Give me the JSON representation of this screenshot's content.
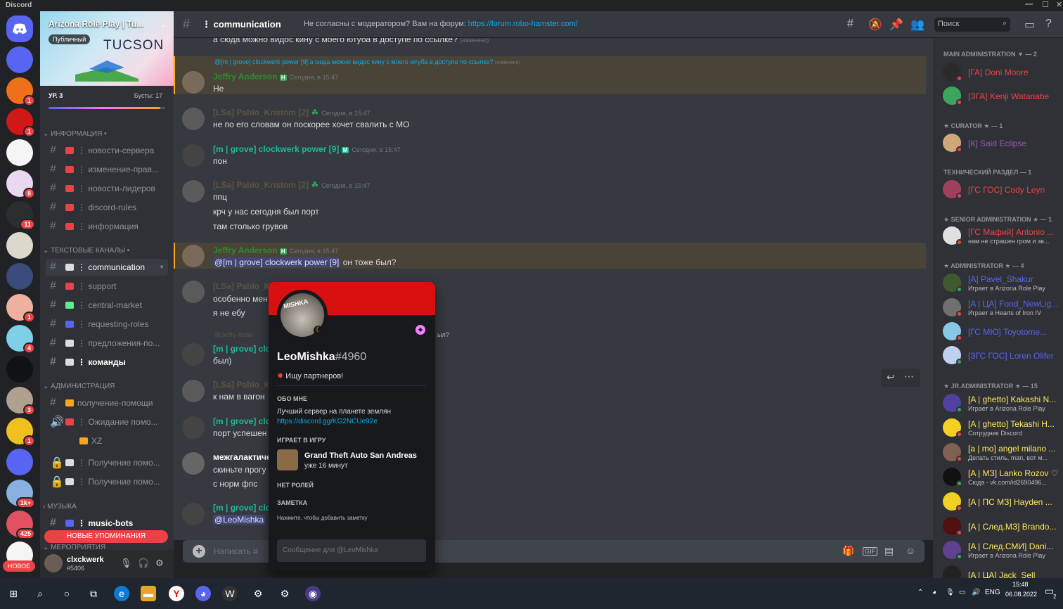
{
  "window": {
    "title": "Discord"
  },
  "rail": {
    "servers": [
      {
        "badge": ""
      },
      {
        "badge": "1"
      },
      {
        "badge": "1"
      },
      {
        "badge": ""
      },
      {
        "badge": "8"
      },
      {
        "badge": "11"
      },
      {
        "badge": ""
      },
      {
        "badge": ""
      },
      {
        "badge": "1"
      },
      {
        "badge": "4"
      },
      {
        "badge": ""
      },
      {
        "badge": "3"
      },
      {
        "badge": "1"
      },
      {
        "badge": ""
      },
      {
        "badge": "1k+"
      },
      {
        "badge": "425"
      },
      {
        "badge": ""
      }
    ],
    "new_label": "НОВОЕ",
    "colors": [
      "#5865f2",
      "#f0701a",
      "#d01818",
      "#f5f5f5",
      "#e8d8f0",
      "#2b2d31",
      "#ddd8cc",
      "#3a4a7a",
      "#f0b0a0",
      "#7ed0e8",
      "#111214",
      "#b0a090",
      "#f0c020",
      "#5865f2",
      "#88b0e0",
      "#e05060",
      "#f5f5f5"
    ]
  },
  "server": {
    "name": "Arizona Role Play | Tu...",
    "public": "Публичный",
    "logo_text": "TUCSON",
    "level": "УР. 3",
    "boosts": "Бусты: 17"
  },
  "categories": [
    {
      "name": "ИНФОРМАЦИЯ ▪"
    },
    {
      "name": "ТЕКСТОВЫЕ КАНАЛЫ ▪"
    },
    {
      "name": "АДМИНИСТРАЦИЯ"
    },
    {
      "name": "МУЗЫКА"
    },
    {
      "name": "МЕРОПРИЯТИЯ"
    }
  ],
  "channels": [
    {
      "name": "⋮ новости-сервера",
      "color": "#ed4245"
    },
    {
      "name": "⋮ изменение-прав...",
      "color": "#ed4245"
    },
    {
      "name": "⋮ новости-лидеров",
      "color": "#ed4245"
    },
    {
      "name": "⋮ discord-rules",
      "color": "#ed4245"
    },
    {
      "name": "⋮ информация",
      "color": "#ed4245"
    },
    {
      "name": "⋮ communication",
      "color": "#dcddde"
    },
    {
      "name": "⋮ support",
      "color": "#ed4245"
    },
    {
      "name": "⋮ central-market",
      "color": "#57f287"
    },
    {
      "name": "⋮ requesting-roles",
      "color": "#5865f2"
    },
    {
      "name": "⋮ предложения-по...",
      "color": "#dcddde"
    },
    {
      "name": "⋮ команды",
      "color": "#dcddde"
    },
    {
      "name": "получение-помощи",
      "color": "#faa61a"
    },
    {
      "name": "⋮ Ожидание помо...",
      "color": "#ed4245"
    },
    {
      "name": "XZ",
      "color": "#faa61a"
    },
    {
      "name": "⋮ Получение помо...",
      "color": "#dcddde"
    },
    {
      "name": "⋮ Получение помо...",
      "color": "#dcddde"
    },
    {
      "name": "⋮ music-bots",
      "color": "#5865f2"
    }
  ],
  "new_mentions": "НОВЫЕ УПОМИНАНИЯ",
  "user": {
    "name": "clxckwerk",
    "tag": "#5406"
  },
  "header": {
    "channel": "⋮ communication",
    "topic": "Не согласны с модератором? Вам на форум:",
    "topic_link": "https://forum.robo-hamster.com/",
    "search_placeholder": "Поиск"
  },
  "messages": {
    "m0": {
      "text": "а сюда можно видос кину с моего ютуба в доступе по ссылке?",
      "edited": "(изменено)"
    },
    "m1": {
      "reply": "@[m | grove] clockwerk power [9] а сюда можно видос кину с моего ютуба в доступе по ссылке?",
      "reply_edited": "(изменено)",
      "author": "Jeffry Anderson",
      "time": "Сегодня, в 15:47",
      "text": "Не"
    },
    "m2": {
      "author": "[LSa] Pablo_Kristom [2]",
      "time": "Сегодня, в 15:47",
      "text": "не по его словам он поскорее хочет свалить с МО"
    },
    "m3": {
      "author": "[m | grove] clockwerk power [9]",
      "time": "Сегодня, в 15:47",
      "text": "пон"
    },
    "m4": {
      "author": "[LSa] Pablo_Kristom [2]",
      "time": "Сегодня, в 15:47",
      "lines": [
        "ппц",
        "крч у нас сегодня был порт",
        "там столько грувов"
      ]
    },
    "m5": {
      "author": "Jeffry Anderson",
      "time": "Сегодня, в 15:47",
      "mention": "@[m | grove] clockwerk power [9]",
      "text": "он тоже был?"
    },
    "m6": {
      "author": "[LSa] Pablo_Kr",
      "lines": [
        "особенно мен",
        "я не ебу"
      ]
    },
    "m7": {
      "reply": "@Jeffry Ande",
      "reply_tail": "ыл?",
      "author": "[m | grove] clo",
      "text": "был)"
    },
    "m8": {
      "author": "[LSa] Pablo_K",
      "text": "к нам в вагон"
    },
    "m9": {
      "author": "[m | grove] clo",
      "text": "порт успешен"
    },
    "m10": {
      "author": "межгалактиче",
      "lines": [
        "скиньте прогу",
        "с норм фпс"
      ]
    },
    "m11": {
      "author": "[m | grove] clo",
      "mention": "@LeoMishka"
    }
  },
  "composer": {
    "placeholder": "Написать #"
  },
  "popout": {
    "username": "LeoMishka",
    "discriminator": "#4960",
    "status": "Ищу партнеров!",
    "about_header": "ОБО МНЕ",
    "about": "Лучший сервер на планете землян",
    "link": "https://discord.gg/KG2NCUe92e",
    "playing_header": "ИГРАЕТ В ИГРУ",
    "game": "Grand Theft Auto San Andreas",
    "game_time": "уже 16 минут",
    "roles": "НЕТ РОЛЕЙ",
    "note_header": "ЗАМЕТКА",
    "note": "Нажмите, чтобы добавить заметку",
    "dm_placeholder": "Сообщение для @LeoMishka",
    "avatar_text": "MISHKA"
  },
  "members": {
    "groups": [
      {
        "title": "MAIN ADMINISTRATION ▼ — 2",
        "items": [
          {
            "name": "[ГА] Doni Moore",
            "color": "#ed4245"
          },
          {
            "name": "[ЗГА] Kenji Watanabe",
            "color": "#ed4245"
          }
        ]
      },
      {
        "title": "★ CURATOR ★ — 1",
        "items": [
          {
            "name": "[К] Said Eclipse",
            "color": "#9b59b6"
          }
        ]
      },
      {
        "title": "ТЕХНИЧЕСКИЙ РАЗДЕЛ — 1",
        "items": [
          {
            "name": "[ГС ГОС] Cody Leyn",
            "color": "#ed4245"
          }
        ]
      },
      {
        "title": "★ SENIOR ADMINISTRATION ★ — 1",
        "items": [
          {
            "name": "[ГС Мафий] Antonio ...",
            "color": "#ed4245",
            "sub": "нам не страшен гром и зв..."
          }
        ]
      },
      {
        "title": "★ ADMINISTRATOR ★ — 4",
        "items": [
          {
            "name": "[A] Pavel_Shakur",
            "color": "#5865f2",
            "sub": "Играет в Arizona Role Play"
          },
          {
            "name": "[A | ЦА] Fond_NewLig...",
            "color": "#5865f2",
            "sub": "Играет в Hearts of Iron IV"
          },
          {
            "name": "[ГС МЮ] Toyotome...",
            "color": "#5865f2"
          },
          {
            "name": "[ЗГС ГОС] Loren Olifer",
            "color": "#5865f2"
          }
        ]
      },
      {
        "title": "★ JR.ADMINISTRATOR ★ — 15",
        "items": [
          {
            "name": "[A | ghetto] Kakashi N...",
            "color": "#fee75c",
            "sub": "Играет в Arizona Role Play"
          },
          {
            "name": "[A | ghetto] Tekashi H...",
            "color": "#fee75c",
            "sub": "Сотрудник Discord"
          },
          {
            "name": "[a | mo] angel milano ...",
            "color": "#fee75c",
            "sub": "Делать стиль, man, вот м..."
          },
          {
            "name": "[A | МЗ] Lanko Rozov ♡",
            "color": "#fee75c",
            "sub": "Сюда - vk.com/id2690496..."
          },
          {
            "name": "[A | ПС МЗ] Hayden ...",
            "color": "#fee75c"
          },
          {
            "name": "[A | След.МЗ] Brando...",
            "color": "#fee75c"
          },
          {
            "name": "[A | След.СМИ] Dani...",
            "color": "#fee75c",
            "sub": "Играет в Arizona Role Play"
          },
          {
            "name": "[A | ЦА] Jack_Sell",
            "color": "#fee75c"
          }
        ]
      }
    ]
  },
  "taskbar": {
    "lang": "ENG",
    "time": "15:48",
    "date": "06.08.2022",
    "notif": "2"
  }
}
